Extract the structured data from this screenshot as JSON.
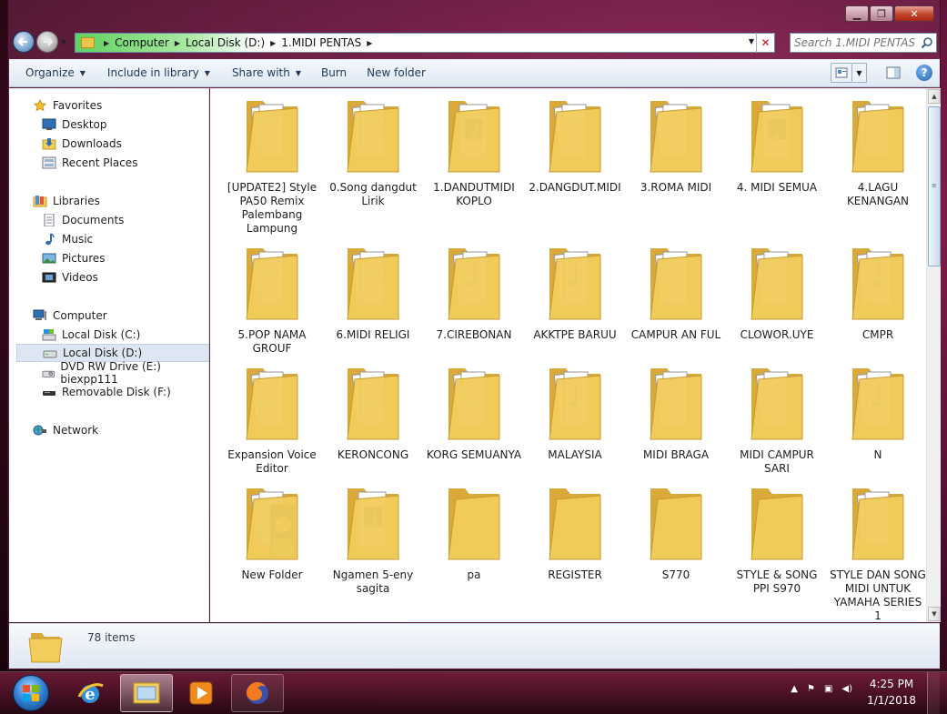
{
  "window": {
    "minimize_glyph": "▁",
    "maximize_glyph": "❐",
    "close_glyph": "✕"
  },
  "address": {
    "crumbs": [
      "Computer",
      "Local Disk (D:)",
      "1.MIDI PENTAS"
    ]
  },
  "search": {
    "placeholder": "Search 1.MIDI PENTAS"
  },
  "toolbar": {
    "organize": "Organize",
    "include": "Include in library",
    "share": "Share with",
    "burn": "Burn",
    "new_folder": "New folder",
    "help": "?"
  },
  "navpane": {
    "favorites": "Favorites",
    "desktop": "Desktop",
    "downloads": "Downloads",
    "recent": "Recent Places",
    "libraries": "Libraries",
    "documents": "Documents",
    "music": "Music",
    "pictures": "Pictures",
    "videos": "Videos",
    "computer": "Computer",
    "disk_c": "Local Disk (C:)",
    "disk_d": "Local Disk (D:)",
    "dvd": "DVD RW Drive (E:) biexpp111",
    "removable": "Removable Disk (F:)",
    "network": "Network"
  },
  "files": [
    {
      "name": "[UPDATE2] Style PA50 Remix Palembang Lampung",
      "icon": "folder-docs-icon"
    },
    {
      "name": "0.Song dangdut Lirik",
      "icon": "folder-docs-icon"
    },
    {
      "name": "1.DANDUTMIDI KOPLO",
      "icon": "folder-media-icon"
    },
    {
      "name": "2.DANGDUT.MIDI",
      "icon": "folder-docs-icon"
    },
    {
      "name": "3.ROMA MIDI",
      "icon": "folder-docs-icon"
    },
    {
      "name": "4. MIDI SEMUA",
      "icon": "folder-media-icon"
    },
    {
      "name": "4.LAGU KENANGAN",
      "icon": "folder-docs-icon"
    },
    {
      "name": "5.POP NAMA GROUF",
      "icon": "folder-docs-icon"
    },
    {
      "name": "6.MIDI RELIGI",
      "icon": "folder-docs-icon"
    },
    {
      "name": "7.CIREBONAN",
      "icon": "folder-music-icon"
    },
    {
      "name": "AKKTPE BARUU",
      "icon": "folder-music-icon"
    },
    {
      "name": "CAMPUR AN FUL",
      "icon": "folder-docs-icon"
    },
    {
      "name": "CLOWOR.UYE",
      "icon": "folder-docs-icon"
    },
    {
      "name": "CMPR",
      "icon": "folder-music-icon"
    },
    {
      "name": "Expansion Voice Editor",
      "icon": "folder-docs-icon"
    },
    {
      "name": "KERONCONG",
      "icon": "folder-docs-icon"
    },
    {
      "name": "KORG SEMUANYA",
      "icon": "folder-docs-icon"
    },
    {
      "name": "MALAYSIA",
      "icon": "folder-music-icon"
    },
    {
      "name": "MIDI BRAGA",
      "icon": "folder-docs-icon"
    },
    {
      "name": "MIDI CAMPUR SARI",
      "icon": "folder-docs-icon"
    },
    {
      "name": "N",
      "icon": "folder-music-icon"
    },
    {
      "name": "New Folder",
      "icon": "folder-photo-icon"
    },
    {
      "name": "Ngamen 5-eny sagita",
      "icon": "folder-media-icon"
    },
    {
      "name": "pa",
      "icon": "folder-empty-icon"
    },
    {
      "name": "REGISTER",
      "icon": "folder-empty-icon"
    },
    {
      "name": "S770",
      "icon": "folder-empty-icon"
    },
    {
      "name": "STYLE & SONG PPI S970",
      "icon": "folder-empty-icon"
    },
    {
      "name": "STYLE DAN SONG MIDI UNTUK YAMAHA SERIES 1",
      "icon": "folder-docs-icon"
    }
  ],
  "details": {
    "count": "78 items"
  },
  "taskbar": {
    "time": "4:25 PM",
    "date": "1/1/2018"
  },
  "colors": {
    "folder": "#f2cd5c",
    "folder_dark": "#d9a93a",
    "accent": "#1e395b",
    "selection": "#dde6f2"
  }
}
